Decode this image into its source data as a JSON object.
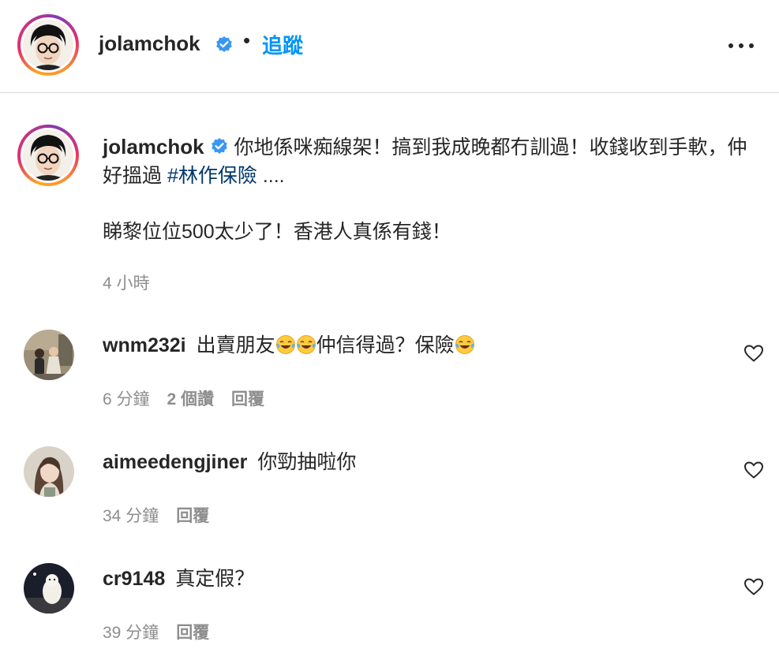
{
  "header": {
    "username": "jolamchok",
    "separator": "•",
    "follow_label": "追蹤",
    "more_icon": "more-horizontal-icon"
  },
  "caption": {
    "username": "jolamchok",
    "text_part1": "你地係咪痴線架！搞到我成晚都冇訓過！收錢收到手軟，仲好搵過",
    "hashtag": "#林作保險",
    "ellipsis": "....",
    "text_line2": "睇黎位位500太少了！香港人真係有錢！",
    "time": "4 小時"
  },
  "comments": [
    {
      "username": "wnm232i",
      "text_a": "出賣朋友",
      "text_b": "仲信得過？保險",
      "time": "6 分鐘",
      "likes": "2 個讚",
      "reply_label": "回覆"
    },
    {
      "username": "aimeedengjiner",
      "text": "你勁抽啦你",
      "time": "34 分鐘",
      "reply_label": "回覆"
    },
    {
      "username": "cr9148",
      "text": "真定假？",
      "time": "39 分鐘",
      "reply_label": "回覆"
    }
  ],
  "colors": {
    "link_blue": "#0095f6",
    "hashtag_blue": "#00376b",
    "muted_gray": "#8e8e8e",
    "verified_blue": "#3897f0"
  }
}
